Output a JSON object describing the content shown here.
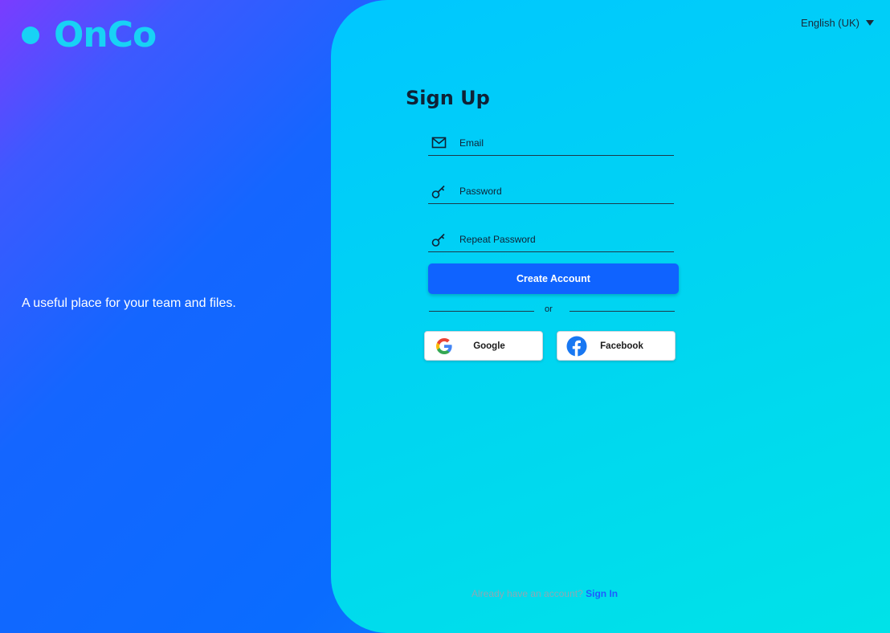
{
  "brand": {
    "name": "OnCo",
    "tagline": "A useful place for your team and files."
  },
  "language": {
    "selected": "English (UK)"
  },
  "form": {
    "title": "Sign Up",
    "email_placeholder": "Email",
    "password_placeholder": "Password",
    "repeat_password_placeholder": "Repeat Password",
    "submit_label": "Create Account",
    "divider_label": "or"
  },
  "social": {
    "google_label": "Google",
    "facebook_label": "Facebook"
  },
  "footer": {
    "prompt": "Already have an account?",
    "signin_label": "Sign In"
  },
  "colors": {
    "accent": "#0f63ff",
    "brand": "#18d2f5",
    "panel": "#00d6f0"
  },
  "icons": [
    "mail-icon",
    "key-icon",
    "key-icon",
    "google-icon",
    "facebook-icon",
    "caret-down-icon"
  ]
}
